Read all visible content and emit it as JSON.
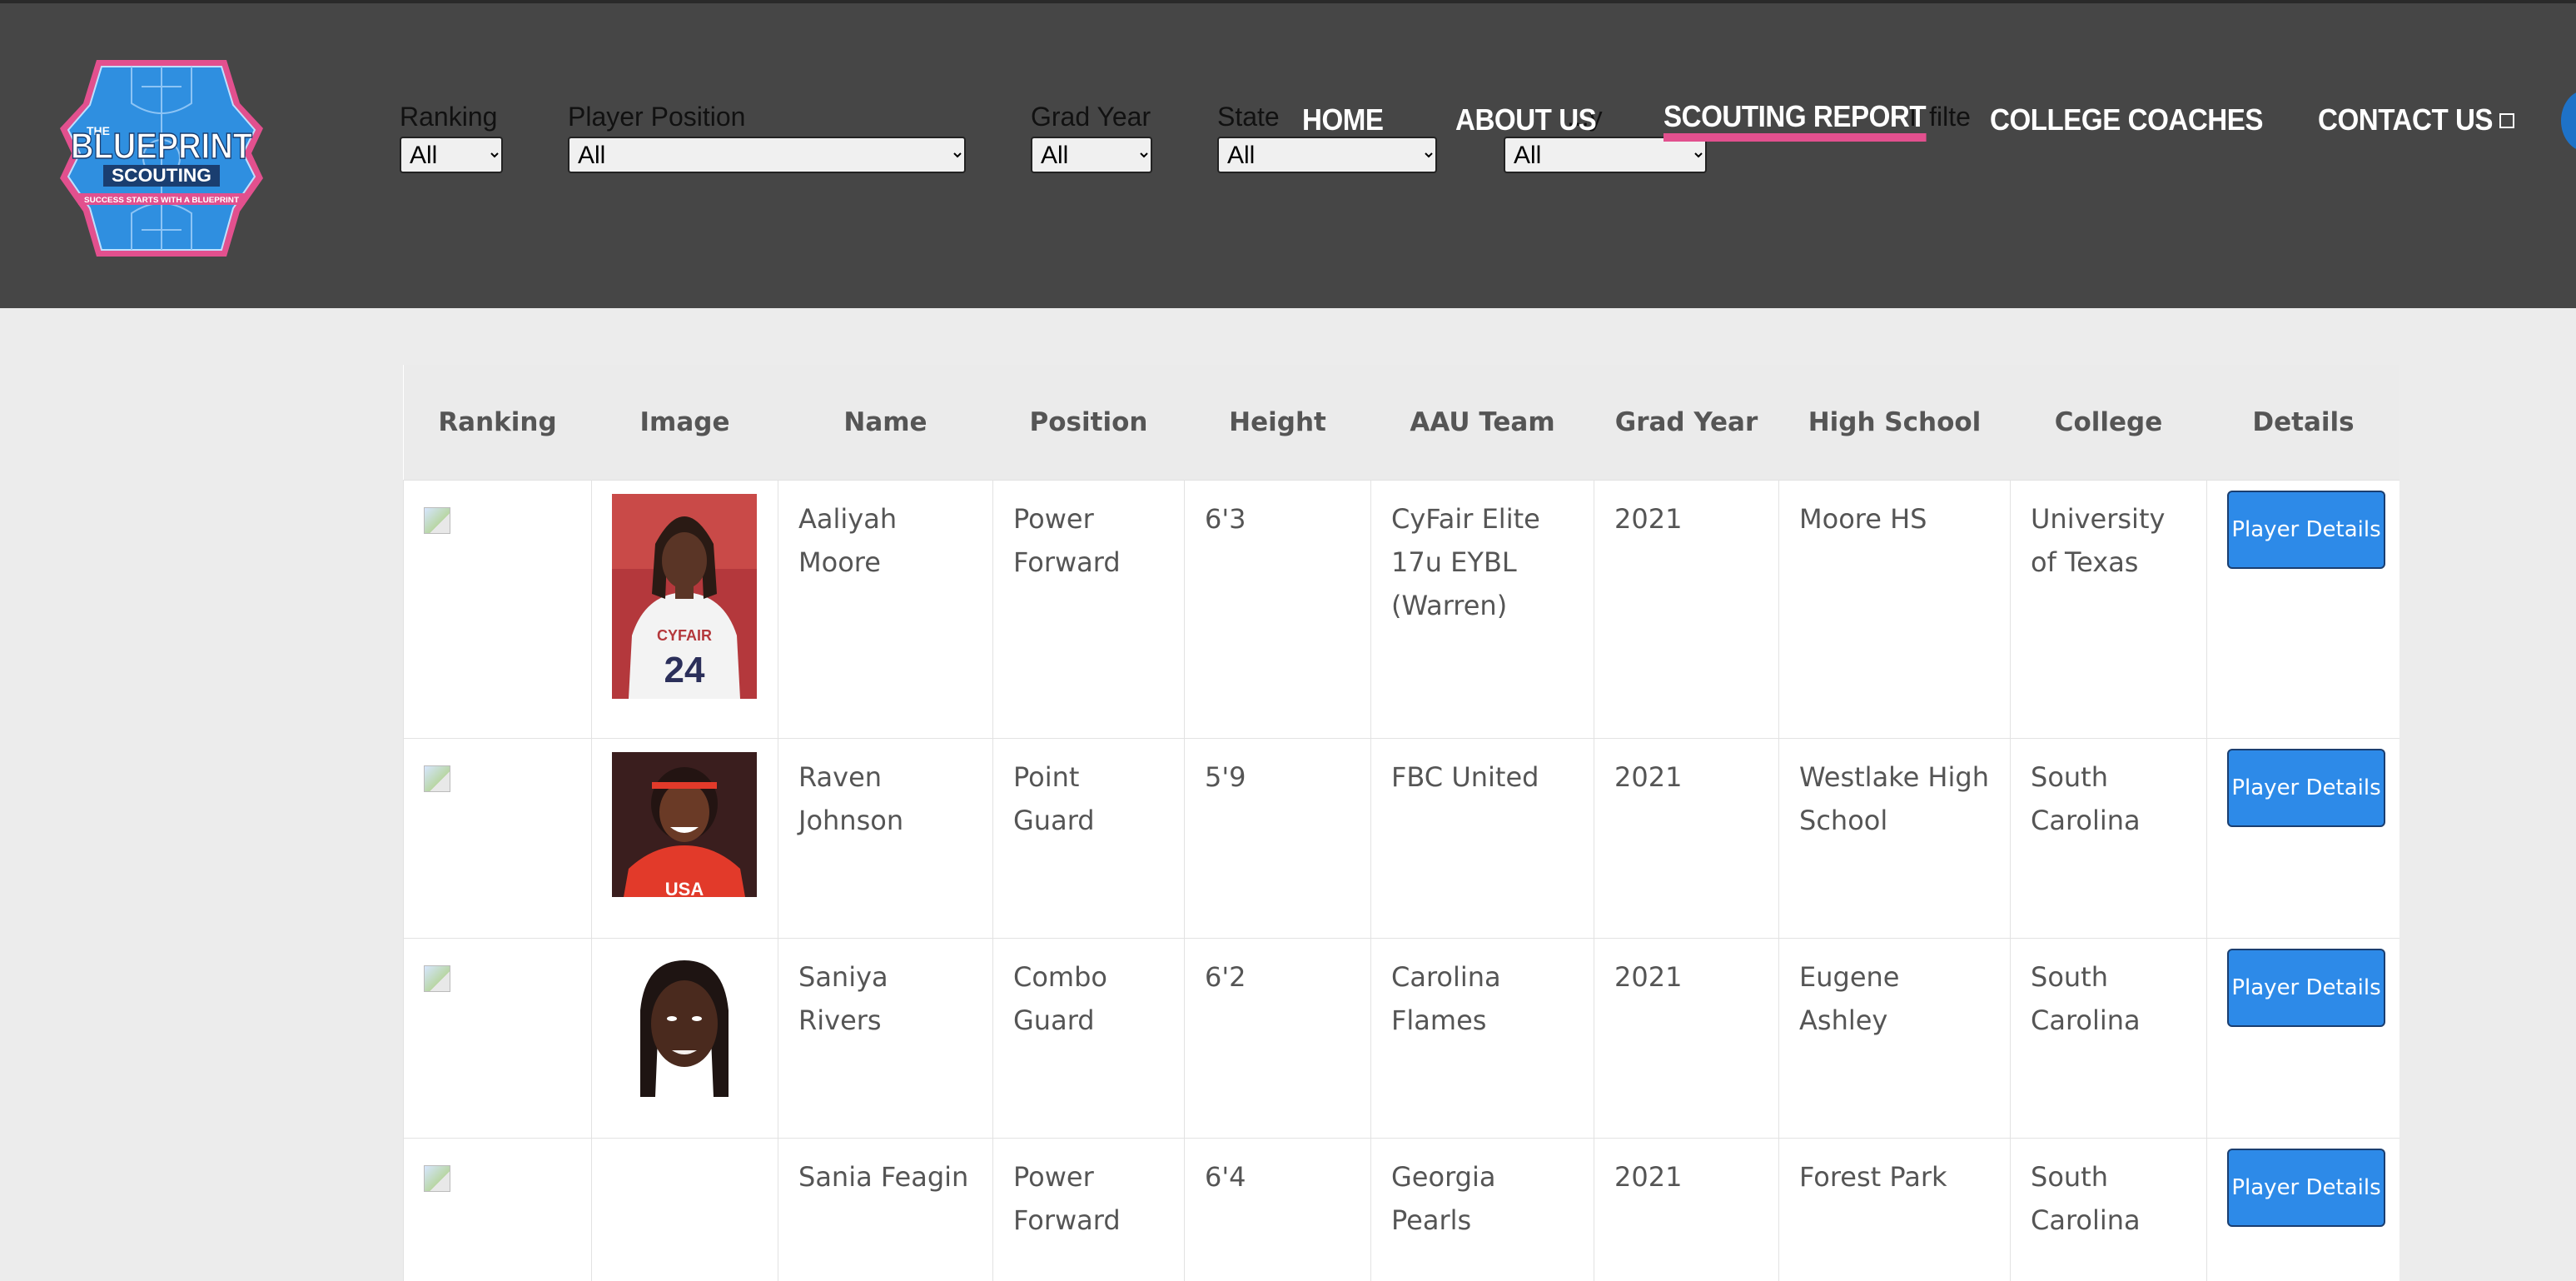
{
  "logo": {
    "top": "THE",
    "brand": "BLUEPRINT",
    "sub": "SCOUTING",
    "tagline": "SUCCESS STARTS WITH A BLUEPRINT"
  },
  "filters": [
    {
      "label": "Ranking",
      "value": "All"
    },
    {
      "label": "Player Position",
      "value": "All"
    },
    {
      "label": "Grad Year",
      "value": "All"
    },
    {
      "label": "State",
      "value": "All"
    },
    {
      "label": "...y",
      "value": "All"
    }
  ],
  "clear_filters_text": "ll filte",
  "nav": [
    {
      "label": "HOME"
    },
    {
      "label": "ABOUT US"
    },
    {
      "label": "SCOUTING REPORT"
    },
    {
      "label": "COLLEGE COACHES"
    },
    {
      "label": "CONTACT US"
    }
  ],
  "colors": {
    "accent_pink": "#e2508e",
    "button_blue": "#2d8ae8",
    "header_bg": "#464646",
    "logo_blue": "#1e72c8"
  },
  "table": {
    "headers": [
      "Ranking",
      "Image",
      "Name",
      "Position",
      "Height",
      "AAU Team",
      "Grad Year",
      "High School",
      "College",
      "Details"
    ],
    "details_label": "Player Details",
    "rows": [
      {
        "name": "Aaliyah Moore",
        "position": "Power Forward",
        "height": "6'3",
        "aau": "CyFair Elite 17u EYBL (Warren)",
        "grad": "2021",
        "school": "Moore HS",
        "college": "University of Texas",
        "jersey": "24",
        "team_text": "CYFAIR"
      },
      {
        "name": "Raven Johnson",
        "position": "Point Guard",
        "height": "5'9",
        "aau": "FBC United",
        "grad": "2021",
        "school": "Westlake High School",
        "college": "South Carolina",
        "jersey": "",
        "team_text": "USA"
      },
      {
        "name": "Saniya Rivers",
        "position": "Combo Guard",
        "height": "6'2",
        "aau": "Carolina Flames",
        "grad": "2021",
        "school": "Eugene Ashley",
        "college": "South Carolina"
      },
      {
        "name": "Sania Feagin",
        "position": "Power Forward",
        "height": "6'4",
        "aau": "Georgia Pearls",
        "grad": "2021",
        "school": "Forest Park",
        "college": "South Carolina"
      }
    ]
  }
}
